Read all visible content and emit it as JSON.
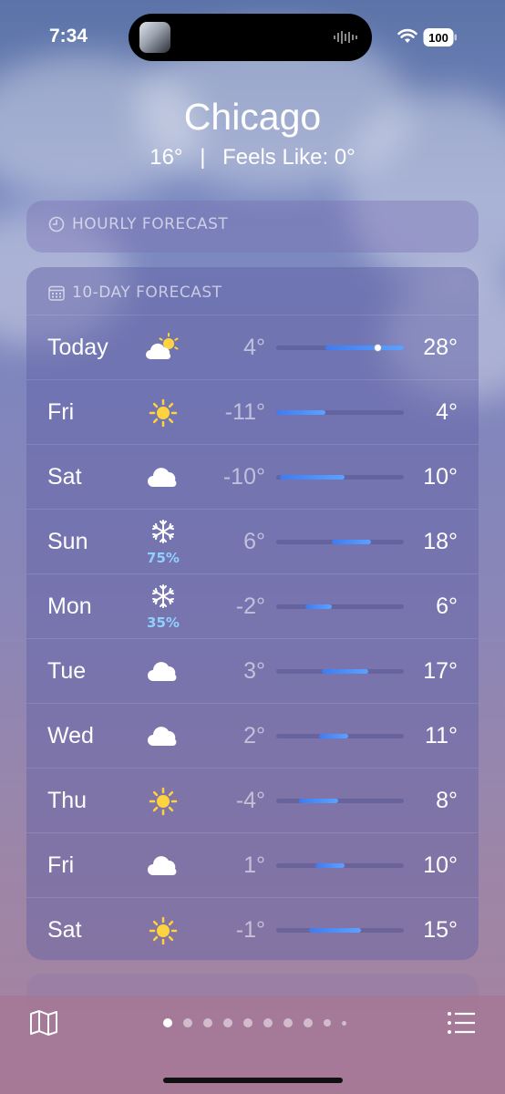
{
  "status_bar": {
    "time": "7:34",
    "battery": "100"
  },
  "location": {
    "city": "Chicago",
    "current_temp": "16°",
    "separator": "|",
    "feels_like": "Feels Like: 0°"
  },
  "hourly_title": "HOURLY FORECAST",
  "forecast_title": "10-DAY FORECAST",
  "range_min": -11,
  "range_max": 28,
  "current_marker": 20,
  "days": [
    {
      "day": "Today",
      "icon": "partly-sunny-icon",
      "low_label": "4°",
      "high_label": "28°",
      "low": 4,
      "high": 28,
      "precip": ""
    },
    {
      "day": "Fri",
      "icon": "sun-icon",
      "low_label": "-11°",
      "high_label": "4°",
      "low": -11,
      "high": 4,
      "precip": ""
    },
    {
      "day": "Sat",
      "icon": "cloud-icon",
      "low_label": "-10°",
      "high_label": "10°",
      "low": -10,
      "high": 10,
      "precip": ""
    },
    {
      "day": "Sun",
      "icon": "snowflake-icon",
      "low_label": "6°",
      "high_label": "18°",
      "low": 6,
      "high": 18,
      "precip": "75%"
    },
    {
      "day": "Mon",
      "icon": "snowflake-icon",
      "low_label": "-2°",
      "high_label": "6°",
      "low": -2,
      "high": 6,
      "precip": "35%"
    },
    {
      "day": "Tue",
      "icon": "cloud-icon",
      "low_label": "3°",
      "high_label": "17°",
      "low": 3,
      "high": 17,
      "precip": ""
    },
    {
      "day": "Wed",
      "icon": "cloud-icon",
      "low_label": "2°",
      "high_label": "11°",
      "low": 2,
      "high": 11,
      "precip": ""
    },
    {
      "day": "Thu",
      "icon": "sun-icon",
      "low_label": "-4°",
      "high_label": "8°",
      "low": -4,
      "high": 8,
      "precip": ""
    },
    {
      "day": "Fri",
      "icon": "cloud-icon",
      "low_label": "1°",
      "high_label": "10°",
      "low": 1,
      "high": 10,
      "precip": ""
    },
    {
      "day": "Sat",
      "icon": "sun-icon",
      "low_label": "-1°",
      "high_label": "15°",
      "low": -1,
      "high": 15,
      "precip": ""
    }
  ],
  "page_dots": {
    "count": 10,
    "active": 0
  },
  "colors": {
    "bar_start": "#3e7bf2",
    "bar_end": "#5ba2ff",
    "precip": "#8fd0ff",
    "sun": "#ffd23f"
  }
}
